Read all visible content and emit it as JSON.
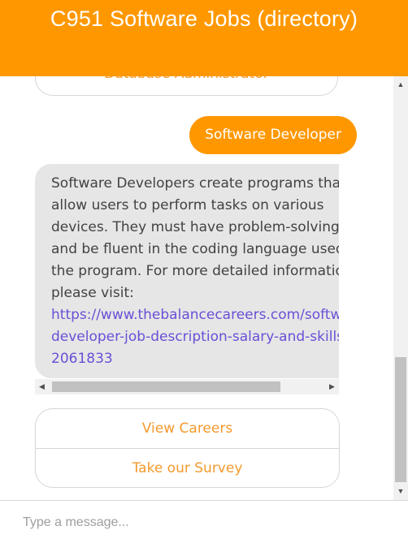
{
  "header": {
    "title": "C951 Software Jobs (directory)"
  },
  "chat": {
    "previous_quick_reply": "Database Administrator",
    "user_message": "Software Developer",
    "bot_message": {
      "lines": [
        "Software Developers create programs that",
        "allow users to perform tasks on various",
        "devices. They must have problem-solving skills",
        "and be fluent in the coding language used for",
        "the program. For more detailed information,",
        "please visit:"
      ],
      "link_lines": [
        "https://www.thebalancecareers.com/software-",
        "developer-job-description-salary-and-skills-",
        "2061833"
      ]
    },
    "quick_replies": [
      "View Careers",
      "Take our Survey"
    ]
  },
  "input": {
    "placeholder": "Type a message..."
  },
  "colors": {
    "accent": "#ff9800",
    "quick_reply_text": "#f39a2c",
    "bot_bubble_bg": "#e6e6e6",
    "link": "#6a4fd6"
  },
  "icons": {
    "scroll_up": "triangle-up-icon",
    "scroll_down": "triangle-down-icon",
    "scroll_left": "triangle-left-icon",
    "scroll_right": "triangle-right-icon"
  }
}
